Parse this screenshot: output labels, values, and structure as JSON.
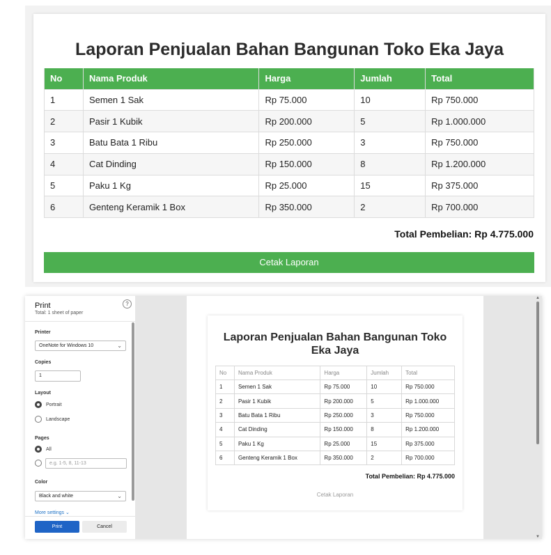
{
  "report": {
    "title": "Laporan Penjualan Bahan Bangunan Toko Eka Jaya",
    "columns": [
      "No",
      "Nama Produk",
      "Harga",
      "Jumlah",
      "Total"
    ],
    "rows": [
      [
        "1",
        "Semen 1 Sak",
        "Rp 75.000",
        "10",
        "Rp 750.000"
      ],
      [
        "2",
        "Pasir 1 Kubik",
        "Rp 200.000",
        "5",
        "Rp 1.000.000"
      ],
      [
        "3",
        "Batu Bata 1 Ribu",
        "Rp 250.000",
        "3",
        "Rp 750.000"
      ],
      [
        "4",
        "Cat Dinding",
        "Rp 150.000",
        "8",
        "Rp 1.200.000"
      ],
      [
        "5",
        "Paku 1 Kg",
        "Rp 25.000",
        "15",
        "Rp 375.000"
      ],
      [
        "6",
        "Genteng Keramik 1 Box",
        "Rp 350.000",
        "2",
        "Rp 700.000"
      ]
    ],
    "total_label": "Total Pembelian: Rp 4.775.000",
    "print_button": "Cetak Laporan",
    "accent_color": "#4caf50"
  },
  "print_dialog": {
    "title": "Print",
    "subtitle": "Total: 1 sheet of paper",
    "help_icon": "?",
    "printer_label": "Printer",
    "printer_value": "OneNote for Windows 10",
    "copies_label": "Copies",
    "copies_value": "1",
    "layout_label": "Layout",
    "layout_portrait": "Portrait",
    "layout_landscape": "Landscape",
    "pages_label": "Pages",
    "pages_all": "All",
    "pages_range_placeholder": "e.g. 1-5, 8, 11-13",
    "color_label": "Color",
    "color_value": "Black and white",
    "more_settings": "More settings",
    "print_button": "Print",
    "cancel_button": "Cancel",
    "primary_color": "#1f64c6"
  }
}
